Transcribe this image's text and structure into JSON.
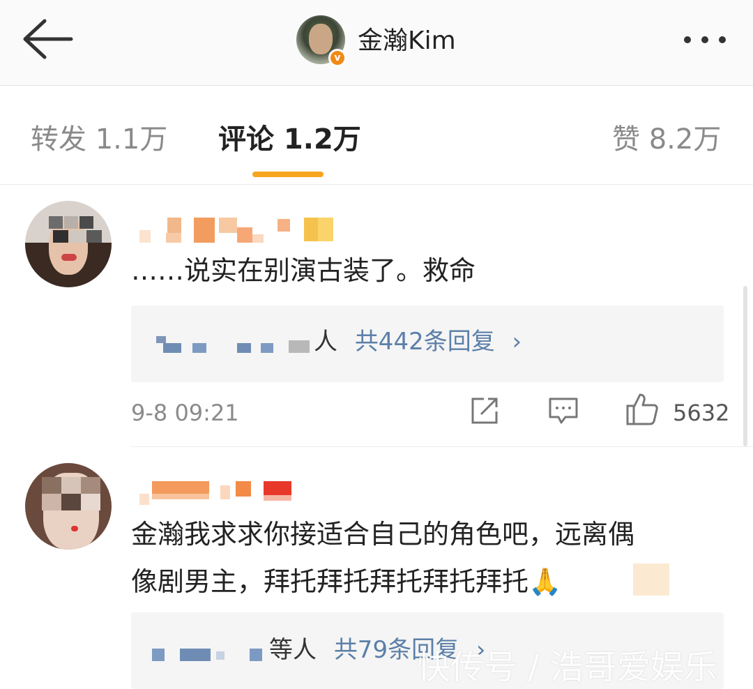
{
  "header": {
    "username": "金瀚Kim",
    "back_icon": "arrow-left-icon",
    "more_icon": "more-dots-icon",
    "verified_icon": "verified-badge-icon"
  },
  "tabs": [
    {
      "label": "转发 1.1万",
      "active": false
    },
    {
      "label": "评论 1.2万",
      "active": true
    },
    {
      "label": "赞 8.2万",
      "active": false
    }
  ],
  "comments": [
    {
      "text": "……说实在别演古装了。救命",
      "reply_people": "人",
      "reply_summary": "共442条回复",
      "chevron": "›",
      "timestamp": "9-8 09:21",
      "likes": "5632"
    },
    {
      "text_line1": "金瀚我求求你接适合自己的角色吧，远离偶",
      "text_line2": "像剧男主，拜托拜托拜托拜托拜托🙏",
      "reply_people": "等人",
      "reply_summary": "共79条回复",
      "chevron": "›"
    }
  ],
  "watermark": "快传号 / 浩哥爱娱乐",
  "colors": {
    "accent_underline": "#f7a51f",
    "link": "#5b7fa8",
    "verified": "#f08a16"
  }
}
